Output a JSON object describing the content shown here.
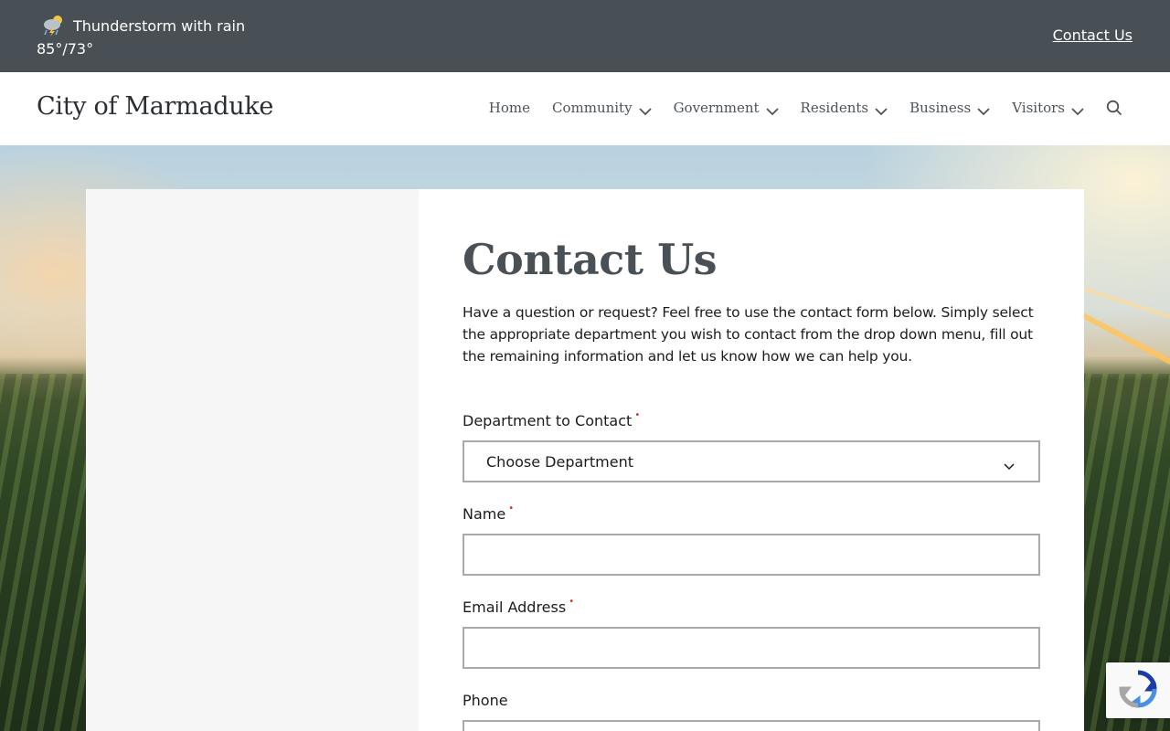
{
  "topbar": {
    "weather_icon": "thunderstorm-rain-icon",
    "weather_condition": "Thunderstorm with rain",
    "temperature": "85°/73°",
    "contact_link": "Contact Us"
  },
  "header": {
    "site_title": "City of Marmaduke",
    "nav": [
      {
        "label": "Home",
        "has_dropdown": false
      },
      {
        "label": "Community",
        "has_dropdown": true
      },
      {
        "label": "Government",
        "has_dropdown": true
      },
      {
        "label": "Residents",
        "has_dropdown": true
      },
      {
        "label": "Business",
        "has_dropdown": true
      },
      {
        "label": "Visitors",
        "has_dropdown": true
      }
    ],
    "search_icon": "search-icon"
  },
  "content": {
    "title": "Contact Us",
    "intro": "Have a question or request?  Feel free to use the contact form below.  Simply select the appropriate department you wish to contact from the drop down menu, fill out the remaining information and let us know how we can help you."
  },
  "form": {
    "department_label": "Department to Contact",
    "department_value": "Choose Department",
    "name_label": "Name",
    "email_label": "Email Address",
    "phone_label": "Phone",
    "required_marker": "•"
  },
  "colors": {
    "topbar_bg": "#485055",
    "title_text": "#4a5156",
    "required": "#c7322f",
    "side_panel": "#f6f6f6"
  }
}
